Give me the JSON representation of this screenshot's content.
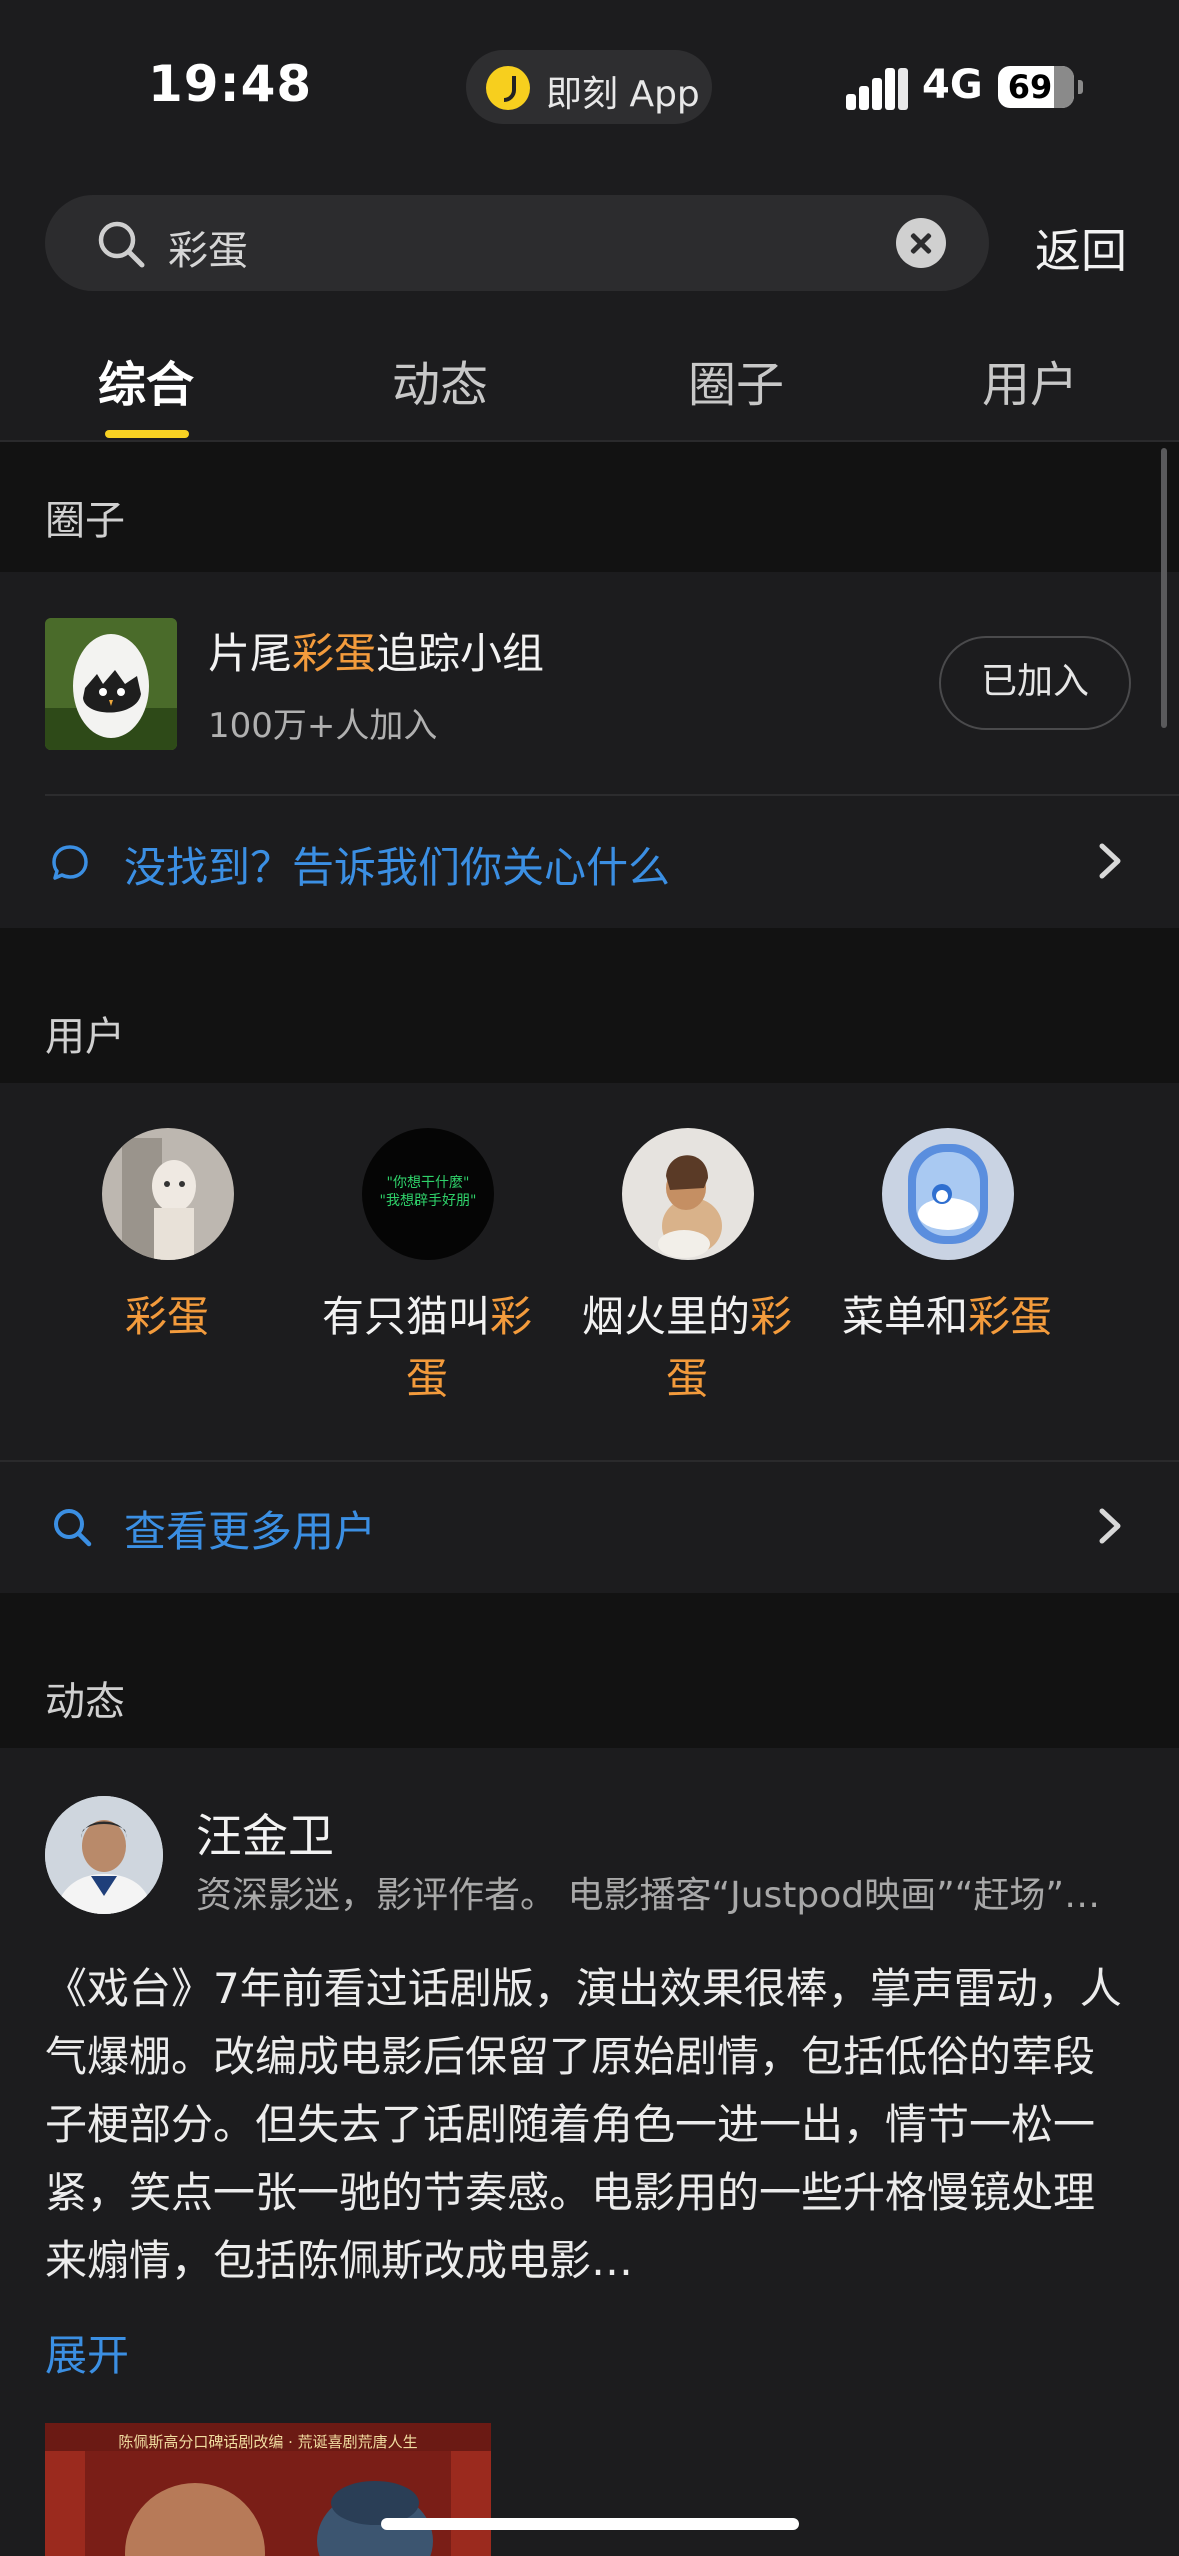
{
  "status_bar": {
    "time": "19:48",
    "app_name": "即刻 App",
    "network": "4G",
    "battery": "69"
  },
  "search": {
    "query": "彩蛋",
    "back_label": "返回"
  },
  "tabs": [
    {
      "label": "综合",
      "active": true
    },
    {
      "label": "动态",
      "active": false
    },
    {
      "label": "圈子",
      "active": false
    },
    {
      "label": "用户",
      "active": false
    }
  ],
  "circles_section": {
    "header": "圈子",
    "circle": {
      "name_prefix": "片尾",
      "name_highlight": "彩蛋",
      "name_suffix": "追踪小组",
      "member_count": "100万+人加入",
      "join_status": "已加入"
    },
    "feedback_text": "没找到？告诉我们你关心什么"
  },
  "users_section": {
    "header": "用户",
    "users": [
      {
        "prefix": "",
        "highlight": "彩蛋",
        "suffix": ""
      },
      {
        "prefix": "有只猫叫",
        "highlight": "彩蛋",
        "suffix": ""
      },
      {
        "prefix": "烟火里的",
        "highlight": "彩蛋",
        "suffix": ""
      },
      {
        "prefix": "菜单和",
        "highlight": "彩蛋",
        "suffix": ""
      }
    ],
    "avatar2_text_line1": "\"你想干什麼\"",
    "avatar2_text_line2": "\"我想辟手好朋\"",
    "more_users": "查看更多用户"
  },
  "posts_section": {
    "header": "动态",
    "post": {
      "author": "汪金卫",
      "bio": "资深影迷，影评作者。 电影播客“Justpod映画”“赶场”…",
      "body": "《戏台》7年前看过话剧版，演出效果很棒，掌声雷动，人气爆棚。改编成电影后保留了原始剧情，包括低俗的荤段子梗部分。但失去了话剧随着角色一进一出，情节一松一紧，笑点一张一驰的节奏感。电影用的一些升格慢镜处理来煽情，包括陈佩斯改成电影…",
      "expand": "展开",
      "image_caption": "陈佩斯高分口碑话剧改编 · 荒诞喜剧荒唐人生"
    }
  },
  "colors": {
    "accent_yellow": "#f8d223",
    "link_blue": "#3b8fe3",
    "highlight_orange": "#f39b3c",
    "background": "#1c1c1e"
  }
}
